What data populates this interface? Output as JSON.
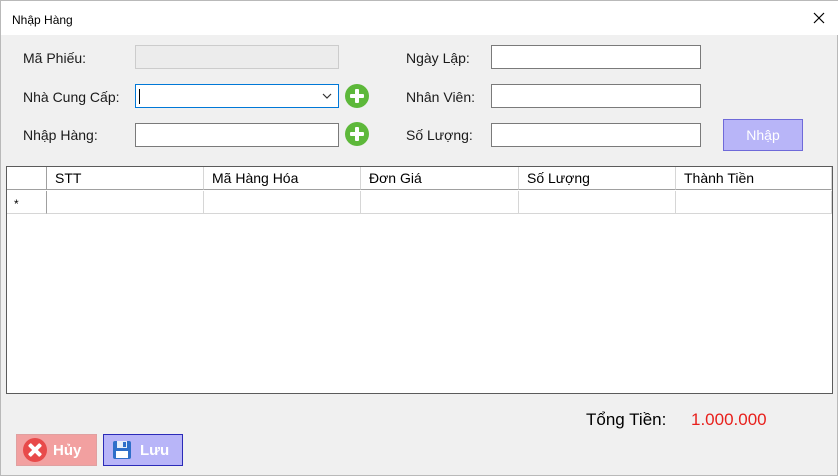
{
  "window": {
    "title": "Nhập Hàng"
  },
  "form": {
    "ma_phieu_label": "Mã Phiếu:",
    "ma_phieu_value": "",
    "nha_cung_cap_label": "Nhà Cung Cấp:",
    "nha_cung_cap_value": "",
    "nhap_hang_label": "Nhập Hàng:",
    "nhap_hang_value": "",
    "ngay_lap_label": "Ngày Lập:",
    "ngay_lap_value": "",
    "nhan_vien_label": "Nhân Viên:",
    "nhan_vien_value": "",
    "so_luong_label": "Số Lượng:",
    "so_luong_value": "",
    "nhap_button": "Nhập"
  },
  "grid": {
    "columns": [
      "STT",
      "Mã Hàng Hóa",
      "Đơn Giá",
      "Số Lượng",
      "Thành Tiền"
    ],
    "new_row_marker": "*",
    "rows": []
  },
  "totals": {
    "label": "Tổng Tiền:",
    "value": "1.000.000",
    "value_color": "#e8201c"
  },
  "buttons": {
    "huy": "Hủy",
    "luu": "Lưu"
  },
  "icons": {
    "close": "close-icon",
    "add_supplier": "plus-circle-icon",
    "add_product": "plus-circle-icon",
    "combo": "chevron-down-icon",
    "cancel": "x-circle-icon",
    "save": "floppy-disk-icon"
  }
}
